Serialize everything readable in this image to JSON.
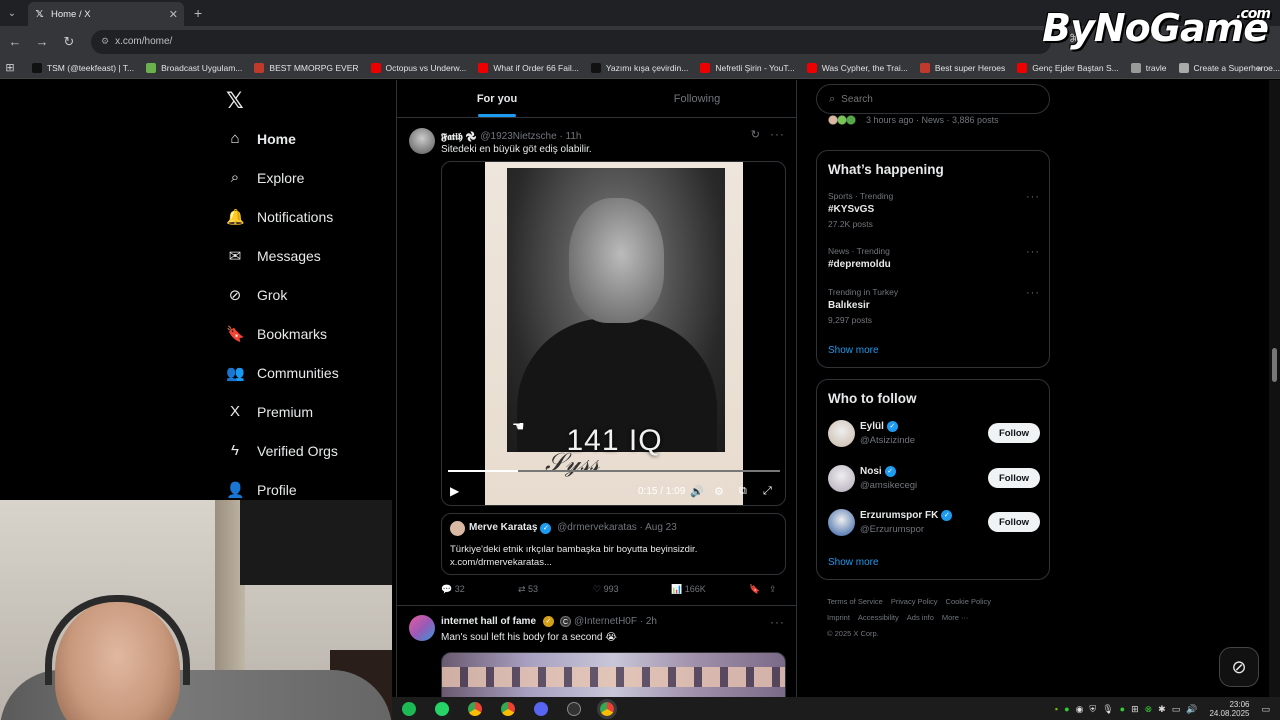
{
  "browser": {
    "tab_title": "Home / X",
    "url": "x.com/home/",
    "bookmarks": [
      {
        "label": "TSM (@teekfeast) | T...",
        "color": "#111"
      },
      {
        "label": "Broadcast Uygulam...",
        "color": "#6ab04c"
      },
      {
        "label": "BEST MMORPG EVER",
        "color": "#c0392b"
      },
      {
        "label": "Octopus vs Underw...",
        "color": "#e00"
      },
      {
        "label": "What if Order 66 Fail...",
        "color": "#e00"
      },
      {
        "label": "Yazımı kışa çevirdin...",
        "color": "#111"
      },
      {
        "label": "Nefretli Şirin - YouT...",
        "color": "#e00"
      },
      {
        "label": "Was Cypher, the Trai...",
        "color": "#e00"
      },
      {
        "label": "Best super Heroes",
        "color": "#c0392b"
      },
      {
        "label": "Genç Ejder Baştan S...",
        "color": "#e00"
      },
      {
        "label": "travle",
        "color": "#999"
      },
      {
        "label": "Create a Superheroe...",
        "color": "#aaa"
      }
    ]
  },
  "watermark": {
    "text": "ByNoGame",
    "suffix": ".com"
  },
  "nav": {
    "items": [
      {
        "label": "Home",
        "icon": "home-icon",
        "glyph": "⌂"
      },
      {
        "label": "Explore",
        "icon": "search-icon",
        "glyph": "⌕"
      },
      {
        "label": "Notifications",
        "icon": "bell-icon",
        "glyph": "🔔"
      },
      {
        "label": "Messages",
        "icon": "mail-icon",
        "glyph": "✉"
      },
      {
        "label": "Grok",
        "icon": "grok-icon",
        "glyph": "⊘"
      },
      {
        "label": "Bookmarks",
        "icon": "bookmark-icon",
        "glyph": "🔖"
      },
      {
        "label": "Communities",
        "icon": "communities-icon",
        "glyph": "👥"
      },
      {
        "label": "Premium",
        "icon": "x-icon",
        "glyph": "X"
      },
      {
        "label": "Verified Orgs",
        "icon": "lightning-icon",
        "glyph": "ϟ"
      },
      {
        "label": "Profile",
        "icon": "profile-icon",
        "glyph": "👤"
      }
    ]
  },
  "feed": {
    "tabs": [
      "For you",
      "Following"
    ],
    "post1": {
      "name": "𝕱𝖆𝖙𝖎𝖍 𖣘",
      "handle": "@1923Nietzsche · 11h",
      "text": "Sitedeki en büyük göt ediş olabilir.",
      "video_caption": "141 IQ",
      "video_time": "0:15 / 1:09",
      "video_progress": 0.21,
      "quote": {
        "name": "Merve Karataş",
        "handle": "@drmervekaratas · Aug 23",
        "text": "Türkiye'deki etnik ırkçılar bambaşka bir boyutta beyinsizdir. x.com/drmervekaratas..."
      },
      "actions": {
        "replies": "32",
        "reposts": "53",
        "likes": "993",
        "views": "166K"
      }
    },
    "post2": {
      "name": "internet hall of fame",
      "badge": "C",
      "handle": "@InternetH0F · 2h",
      "text": "Man's soul left his body for a second 😭"
    }
  },
  "sidebar": {
    "search_placeholder": "Search",
    "news_line": "3 hours ago · News · 3,886 posts",
    "whats_happening": {
      "title": "What’s happening",
      "trends": [
        {
          "meta": "Sports · Trending",
          "name": "#KYSvGS",
          "count": "27.2K posts"
        },
        {
          "meta": "News · Trending",
          "name": "#depremoldu",
          "count": ""
        },
        {
          "meta": "Trending in Turkey",
          "name": "Balıkesir",
          "count": "9,297 posts"
        }
      ],
      "show_more": "Show more"
    },
    "who_to_follow": {
      "title": "Who to follow",
      "accounts": [
        {
          "name": "Eylül",
          "handle": "@Atsizizinde",
          "button": "Follow",
          "color": "#c9b8a8"
        },
        {
          "name": "Nosi",
          "handle": "@amsikecegi",
          "button": "Follow",
          "color": "#b0a8b8"
        },
        {
          "name": "Erzurumspor FK",
          "handle": "@Erzurumspor",
          "button": "Follow",
          "color": "#2c5aa0"
        }
      ],
      "show_more": "Show more"
    },
    "footer": [
      "Terms of Service",
      "Privacy Policy",
      "Cookie Policy",
      "Imprint",
      "Accessibility",
      "Ads info",
      "More ···",
      "© 2025 X Corp."
    ]
  },
  "taskbar": {
    "time": "23:06",
    "date": "24.08.2025"
  }
}
